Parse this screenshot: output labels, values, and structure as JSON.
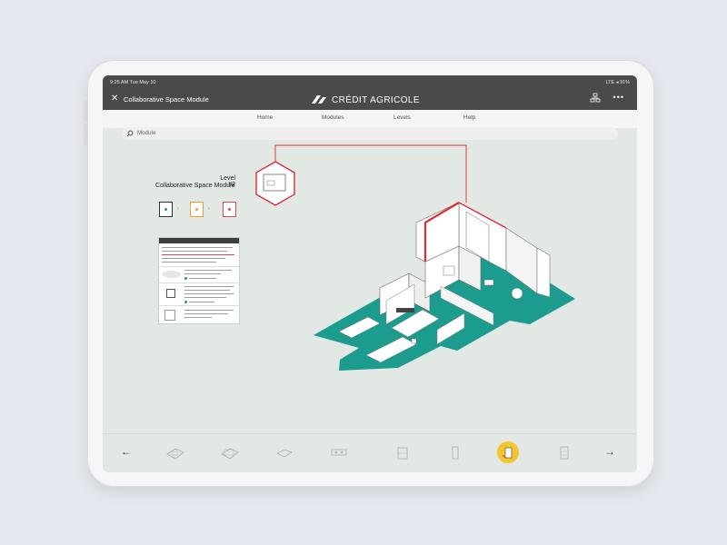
{
  "status": {
    "time_date": "9:25 AM  Tue May 10",
    "right": "LTE ◂ 91%"
  },
  "header": {
    "close_glyph": "✕",
    "title": "Collaborative Space Module",
    "logo_text": "CRÉDIT AGRICOLE",
    "more_glyph": "•••"
  },
  "nav": {
    "items": [
      "Home",
      "Modules",
      "Levels",
      "Help"
    ]
  },
  "search": {
    "placeholder": "Module"
  },
  "panel": {
    "level_title": "Level #2",
    "subtitle": "Collaborative Space Module"
  },
  "bottom": {
    "prev_glyph": "←",
    "next_glyph": "→"
  },
  "colors": {
    "teal": "#1b9c8f",
    "red": "#e02a36",
    "yellow": "#f6c42d",
    "header": "#4a4a4a",
    "bg": "#e2e9e4"
  }
}
